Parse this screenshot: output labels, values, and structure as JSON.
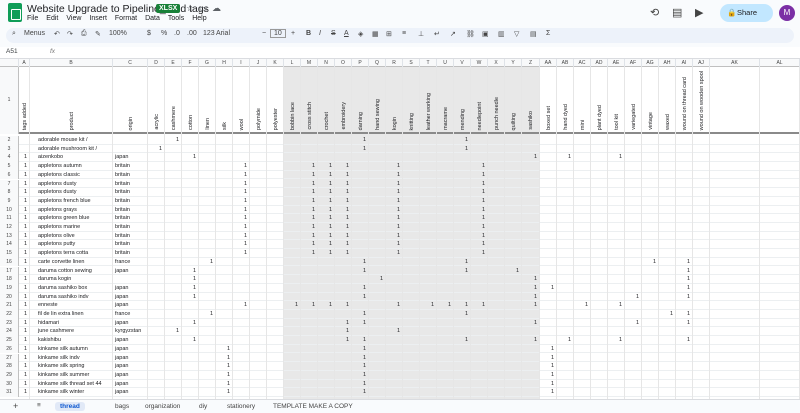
{
  "doc": {
    "title": "Website Upgrade to Pipeline_ add tags",
    "badge": "XLSX"
  },
  "menu": [
    "File",
    "Edit",
    "View",
    "Insert",
    "Format",
    "Data",
    "Tools",
    "Help"
  ],
  "share_label": "Share",
  "avatar_letter": "M",
  "toolbar": {
    "search": "Menus",
    "zoom": "100%",
    "currency": "$",
    "percent": "%",
    "dec_minus": ".0",
    "dec_plus": ".00",
    "num": "123",
    "font": "Arial",
    "font_size": "10"
  },
  "formula": {
    "cell": "A51",
    "fx": "fx"
  },
  "colletters": [
    "A",
    "B",
    "C",
    "D",
    "E",
    "F",
    "G",
    "H",
    "I",
    "J",
    "K",
    "L",
    "M",
    "N",
    "O",
    "P",
    "Q",
    "R",
    "S",
    "T",
    "U",
    "V",
    "W",
    "X",
    "Y",
    "Z",
    "AA",
    "AB",
    "AC",
    "AD",
    "AE",
    "AF",
    "AG",
    "AH",
    "AI",
    "AJ",
    "AK",
    "AL"
  ],
  "headers": [
    "tags added",
    "product",
    "origin",
    "acrylic",
    "cashmere",
    "cotton",
    "linen",
    "silk",
    "wool",
    "polymide",
    "polyester",
    "bobbin lace",
    "cross stitch",
    "crochet",
    "embroidery",
    "darning",
    "hand sewing",
    "kogin",
    "knitting",
    "leather working",
    "macrame",
    "mending",
    "needlepoint",
    "punch needle",
    "quilting",
    "sashiko",
    "boxed set",
    "hand dyed",
    "mini",
    "plant dyed",
    "tool kit",
    "variegated",
    "vintage",
    "waxed",
    "wound on thread card",
    "wound on wooden spool"
  ],
  "rows": [
    {
      "n": "2",
      "a": "",
      "p": "adorable mouse kit /",
      "o": "",
      "m": [
        4,
        15,
        21
      ]
    },
    {
      "n": "3",
      "a": "",
      "p": "adorable mushroom kit /",
      "o": "",
      "m": [
        3,
        15,
        21
      ]
    },
    {
      "n": "4",
      "a": "1",
      "p": "aizenkobo",
      "o": "japan",
      "m": [
        5,
        25,
        27,
        30
      ]
    },
    {
      "n": "5",
      "a": "1",
      "p": "appletons autumn",
      "o": "britain",
      "m": [
        8,
        12,
        13,
        14,
        17,
        22
      ]
    },
    {
      "n": "6",
      "a": "1",
      "p": "appletons classic",
      "o": "britain",
      "m": [
        8,
        12,
        13,
        14,
        17,
        22
      ]
    },
    {
      "n": "7",
      "a": "1",
      "p": "appletons dusty",
      "o": "britain",
      "m": [
        8,
        12,
        13,
        14,
        17,
        22
      ]
    },
    {
      "n": "8",
      "a": "1",
      "p": "appletons dusty",
      "o": "britain",
      "m": [
        8,
        12,
        13,
        14,
        17,
        22
      ]
    },
    {
      "n": "9",
      "a": "1",
      "p": "appletons french blue",
      "o": "britain",
      "m": [
        8,
        12,
        13,
        14,
        17,
        22
      ]
    },
    {
      "n": "10",
      "a": "1",
      "p": "appletons grays",
      "o": "britain",
      "m": [
        8,
        12,
        13,
        14,
        17,
        22
      ]
    },
    {
      "n": "11",
      "a": "1",
      "p": "appletons green blue",
      "o": "britain",
      "m": [
        8,
        12,
        13,
        14,
        17,
        22
      ]
    },
    {
      "n": "12",
      "a": "1",
      "p": "appletons marine",
      "o": "britain",
      "m": [
        8,
        12,
        13,
        14,
        17,
        22
      ]
    },
    {
      "n": "13",
      "a": "1",
      "p": "appletons olive",
      "o": "britain",
      "m": [
        8,
        12,
        13,
        14,
        17,
        22
      ]
    },
    {
      "n": "14",
      "a": "1",
      "p": "appletons putty",
      "o": "britain",
      "m": [
        8,
        12,
        13,
        14,
        17,
        22
      ]
    },
    {
      "n": "15",
      "a": "1",
      "p": "appletons terra cotta",
      "o": "britain",
      "m": [
        8,
        12,
        13,
        14,
        17,
        22
      ]
    },
    {
      "n": "16",
      "a": "1",
      "p": "carte corvette linen",
      "o": "france",
      "m": [
        6,
        15,
        21,
        32,
        34
      ]
    },
    {
      "n": "17",
      "a": "1",
      "p": "daruma cotton sewing",
      "o": "japan",
      "m": [
        5,
        15,
        21,
        24,
        34
      ]
    },
    {
      "n": "18",
      "a": "1",
      "p": "daruma kogin",
      "o": "",
      "m": [
        5,
        16,
        25,
        34
      ]
    },
    {
      "n": "19",
      "a": "1",
      "p": "daruma sashiko box",
      "o": "japan",
      "m": [
        5,
        15,
        25,
        26,
        34
      ]
    },
    {
      "n": "20",
      "a": "1",
      "p": "daruma sashiko indv",
      "o": "japan",
      "m": [
        5,
        15,
        25,
        31,
        34
      ]
    },
    {
      "n": "21",
      "a": "1",
      "p": "enneste",
      "o": "japan",
      "m": [
        8,
        11,
        12,
        13,
        14,
        17,
        19,
        20,
        21,
        22,
        25,
        28,
        30
      ]
    },
    {
      "n": "22",
      "a": "1",
      "p": "fil de lin extra linen",
      "o": "france",
      "m": [
        6,
        15,
        21,
        33,
        34
      ]
    },
    {
      "n": "23",
      "a": "1",
      "p": "hidamari",
      "o": "japan",
      "m": [
        5,
        14,
        15,
        25,
        31,
        34
      ]
    },
    {
      "n": "24",
      "a": "1",
      "p": "june cashmere",
      "o": "kyrgyzstan",
      "m": [
        4,
        14,
        17
      ]
    },
    {
      "n": "25",
      "a": "1",
      "p": "kakishibu",
      "o": "japan",
      "m": [
        5,
        14,
        15,
        21,
        25,
        27,
        30,
        34
      ]
    },
    {
      "n": "26",
      "a": "1",
      "p": "kinkame silk autumn",
      "o": "japan",
      "m": [
        7,
        15,
        26
      ]
    },
    {
      "n": "27",
      "a": "1",
      "p": "kinkame silk indv",
      "o": "japan",
      "m": [
        7,
        15,
        26
      ]
    },
    {
      "n": "28",
      "a": "1",
      "p": "kinkame silk spring",
      "o": "japan",
      "m": [
        7,
        15,
        26
      ]
    },
    {
      "n": "29",
      "a": "1",
      "p": "kinkame silk summer",
      "o": "japan",
      "m": [
        7,
        15,
        26
      ]
    },
    {
      "n": "30",
      "a": "1",
      "p": "kinkame silk thread set 44",
      "o": "japan",
      "m": [
        7,
        15,
        26
      ]
    },
    {
      "n": "31",
      "a": "1",
      "p": "kinkame silk winter",
      "o": "japan",
      "m": [
        7,
        15,
        26
      ]
    }
  ],
  "sheets": [
    "thread",
    "bags",
    "organization",
    "diy",
    "stationery",
    "TEMPLATE MAKE A COPY"
  ]
}
